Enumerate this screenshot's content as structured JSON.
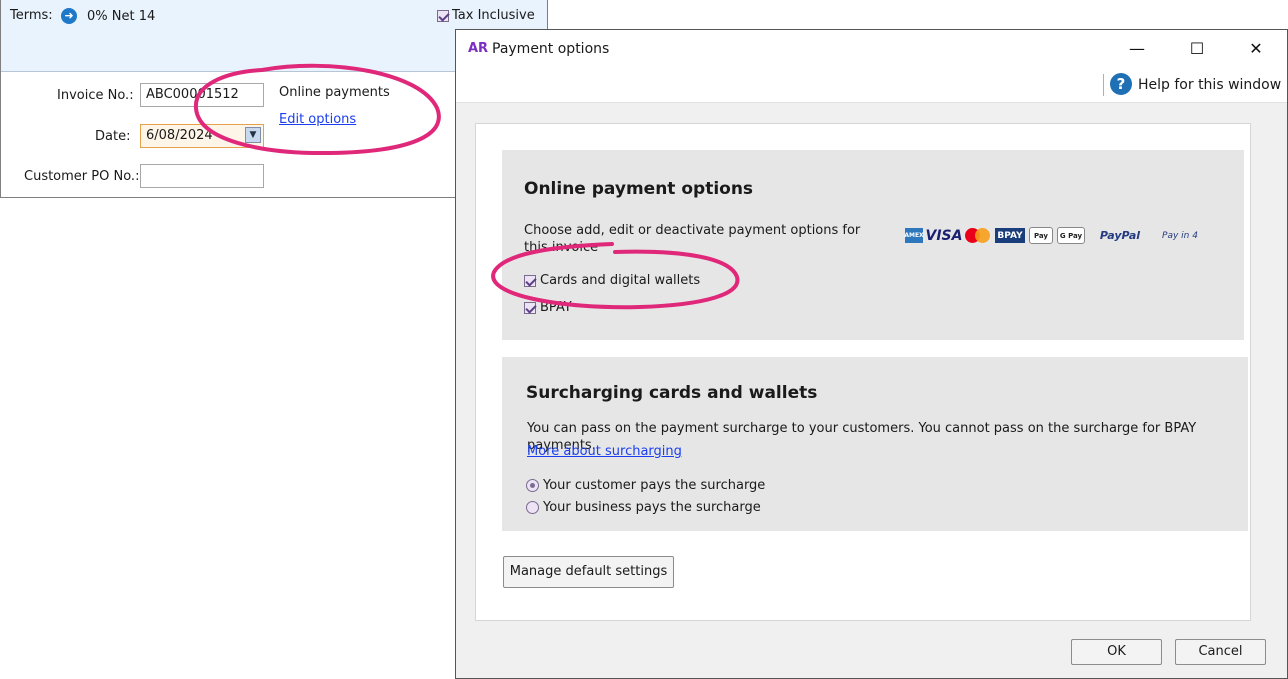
{
  "invoice": {
    "terms_label": "Terms:",
    "terms_value": "0% Net 14",
    "tax_inclusive_label": "Tax Inclusive",
    "tax_inclusive_checked": true,
    "invoice_no_label": "Invoice No.:",
    "invoice_no_value": "ABC00001512",
    "date_label": "Date:",
    "date_value": "6/08/2024",
    "customer_po_label": "Customer PO No.:",
    "customer_po_value": "",
    "online_payments_label": "Online payments",
    "edit_options_link": "Edit options"
  },
  "dialog": {
    "logo": "AR",
    "title": "Payment options",
    "minimize_icon": "minimize-icon",
    "maximize_icon": "maximize-icon",
    "close_icon": "close-icon",
    "help_label": "Help for this window",
    "online_section": {
      "title": "Online payment options",
      "description": "Choose add, edit or deactivate payment options for this invoice",
      "logos": [
        "AMEX",
        "VISA",
        "Mastercard",
        "BPAY",
        "Apple Pay",
        "G Pay",
        "PayPal",
        "Pay in 4"
      ],
      "options": [
        {
          "label": "Cards and digital wallets",
          "checked": true
        },
        {
          "label": "BPAY",
          "checked": true
        }
      ]
    },
    "surcharge_section": {
      "title": "Surcharging cards and wallets",
      "description": "You can pass on the payment surcharge to your customers. You cannot pass on the surcharge for BPAY payments.",
      "more_link": "More about surcharging",
      "options": [
        {
          "label": "Your customer pays the surcharge",
          "selected": true
        },
        {
          "label": "Your business pays the surcharge",
          "selected": false
        }
      ]
    },
    "manage_button": "Manage default settings",
    "ok_button": "OK",
    "cancel_button": "Cancel"
  },
  "colors": {
    "annotation": "#e0287a",
    "accent": "#7b2fc0",
    "link": "#1a3ef0"
  }
}
